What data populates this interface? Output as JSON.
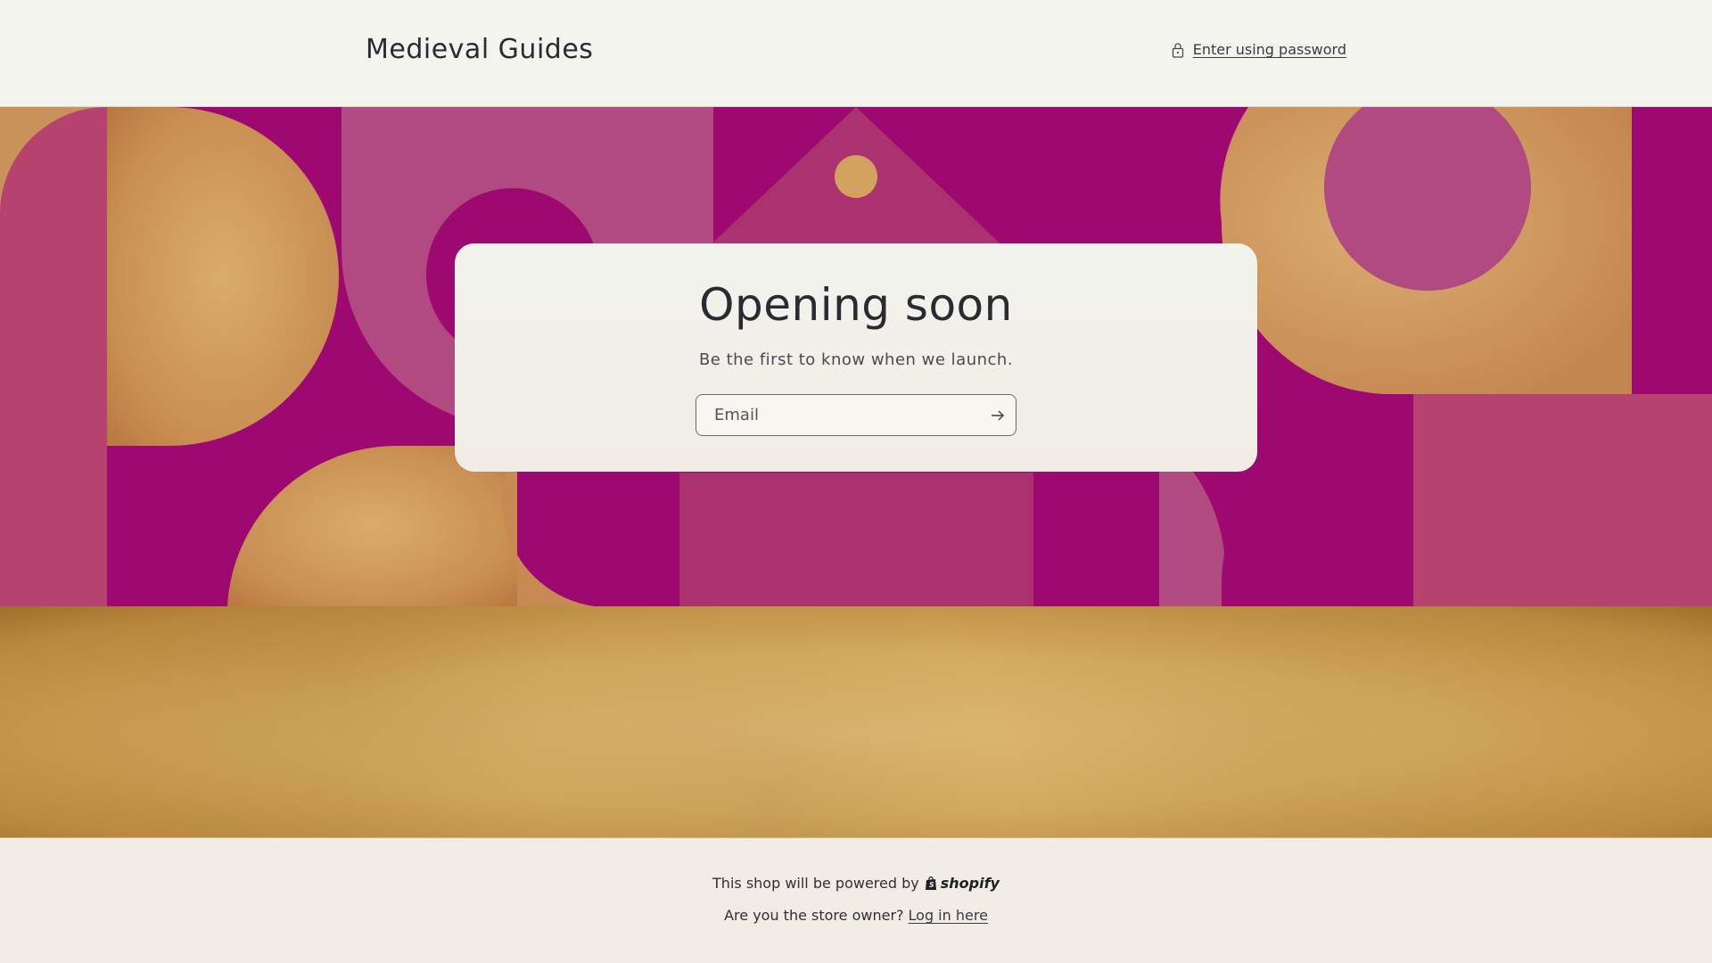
{
  "header": {
    "brand": "Medieval Guides",
    "password_link": "Enter using password",
    "lock_icon": "lock-icon"
  },
  "hero": {
    "colors": {
      "magenta": "#9e0871",
      "pink": "#b04a80",
      "parchment": "#d3a25f"
    }
  },
  "card": {
    "title": "Opening soon",
    "subtitle": "Be the first to know when we launch.",
    "email_placeholder": "Email",
    "submit_icon": "arrow-right-icon"
  },
  "footer": {
    "powered_text": "This shop will be powered by",
    "shopify_label": "shopify",
    "owner_text": "Are you the store owner?",
    "login_link": "Log in here"
  }
}
